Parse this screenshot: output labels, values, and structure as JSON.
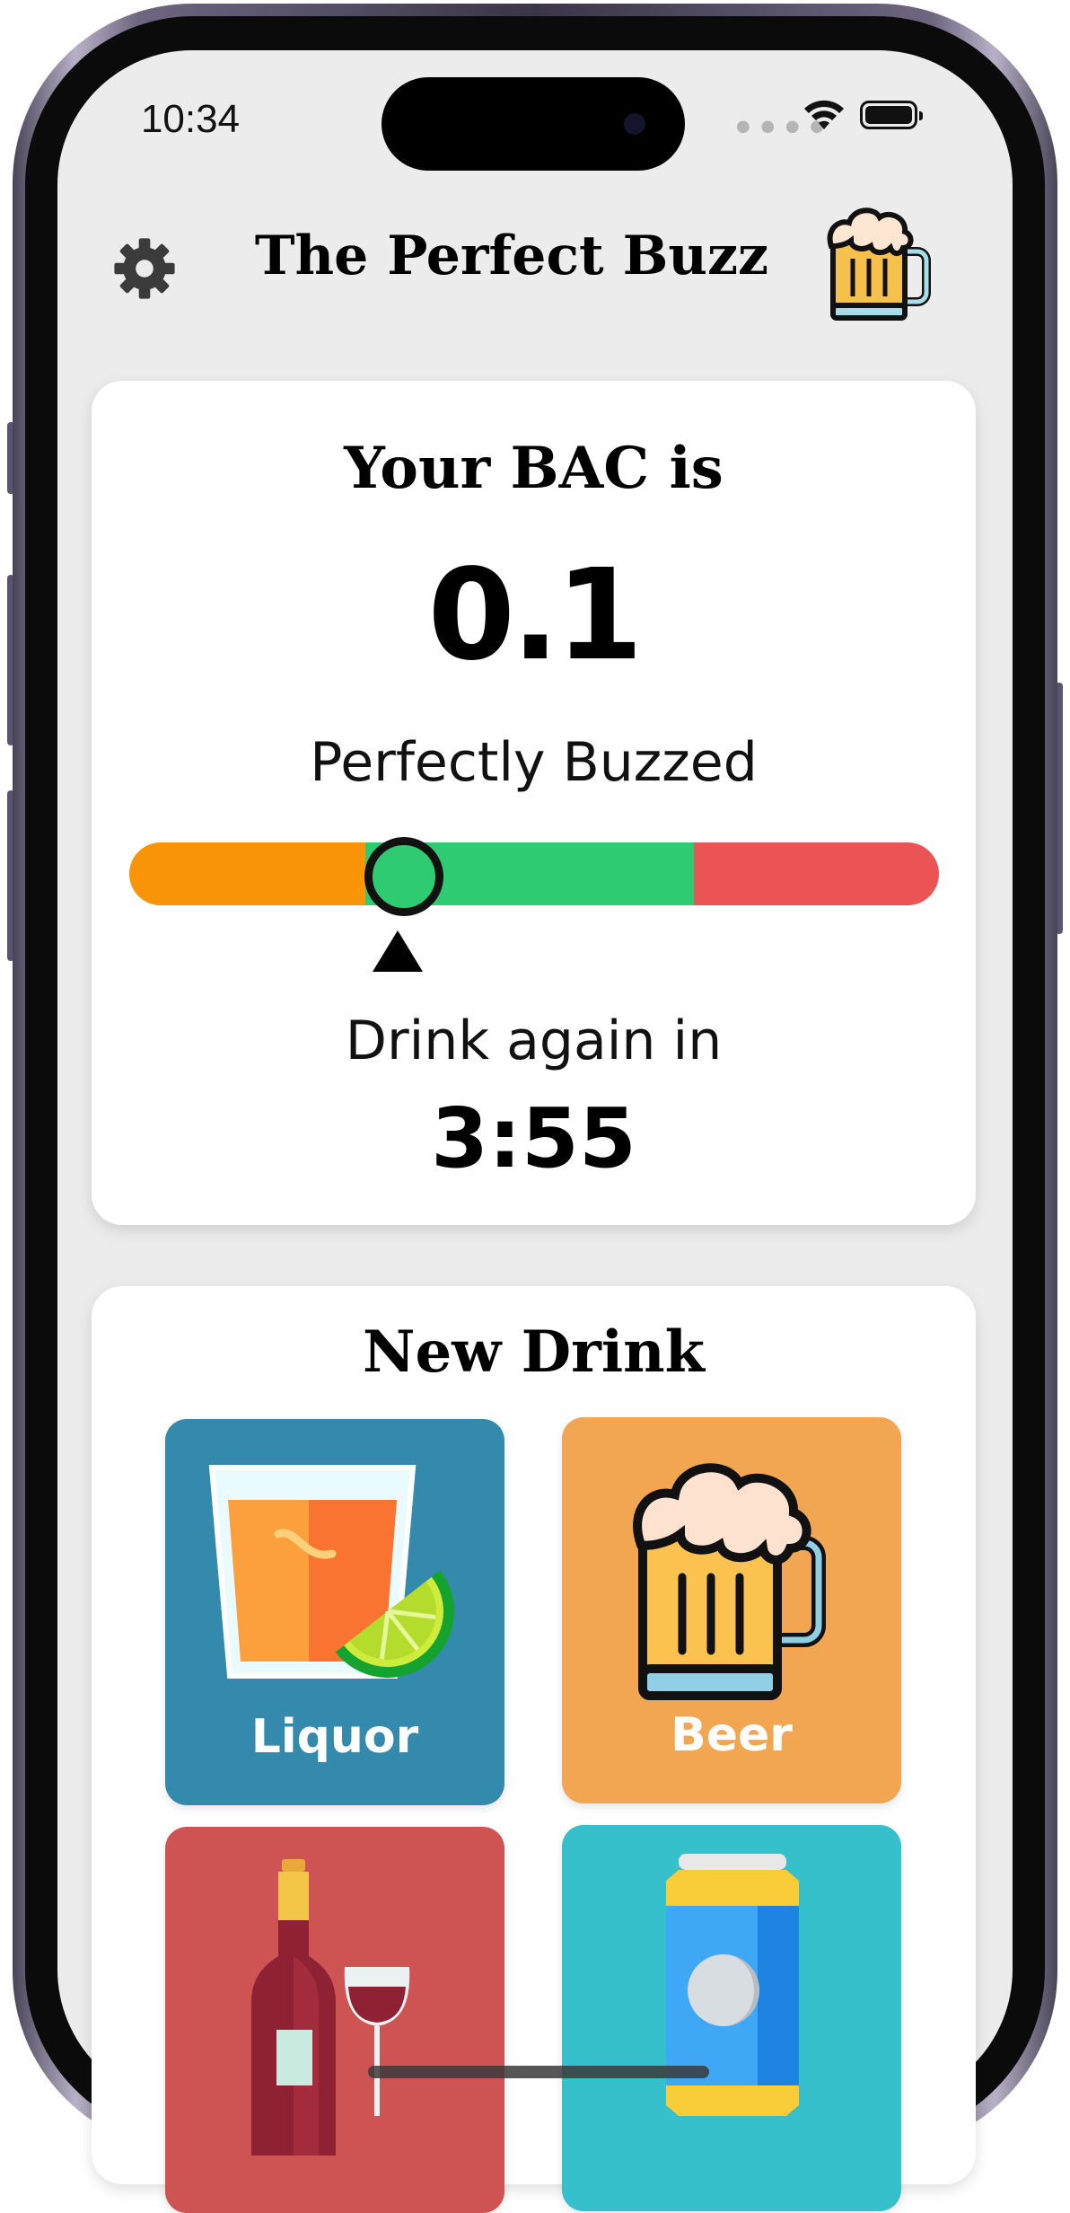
{
  "status_bar": {
    "time": "10:34"
  },
  "header": {
    "title": "The Perfect Buzz"
  },
  "bac_card": {
    "label": "Your BAC is",
    "value": "0.1",
    "status": "Perfectly Buzzed",
    "gauge_level": 0.34,
    "again_label": "Drink again in",
    "again_timer": "3:55"
  },
  "new_drink": {
    "title": "New Drink",
    "tiles": [
      {
        "label": "Liquor",
        "icon": "liquor-glass-icon",
        "color": "#348aad"
      },
      {
        "label": "Beer",
        "icon": "beer-mug-icon",
        "color": "#f2a652"
      },
      {
        "label": "",
        "icon": "wine-bottle-icon",
        "color": "#ce5353"
      },
      {
        "label": "",
        "icon": "beer-can-icon",
        "color": "#36c0cb"
      }
    ]
  },
  "colors": {
    "gauge_low": "#fa950a",
    "gauge_mid": "#2fcb72",
    "gauge_high": "#ea5455",
    "background": "#ececec"
  }
}
